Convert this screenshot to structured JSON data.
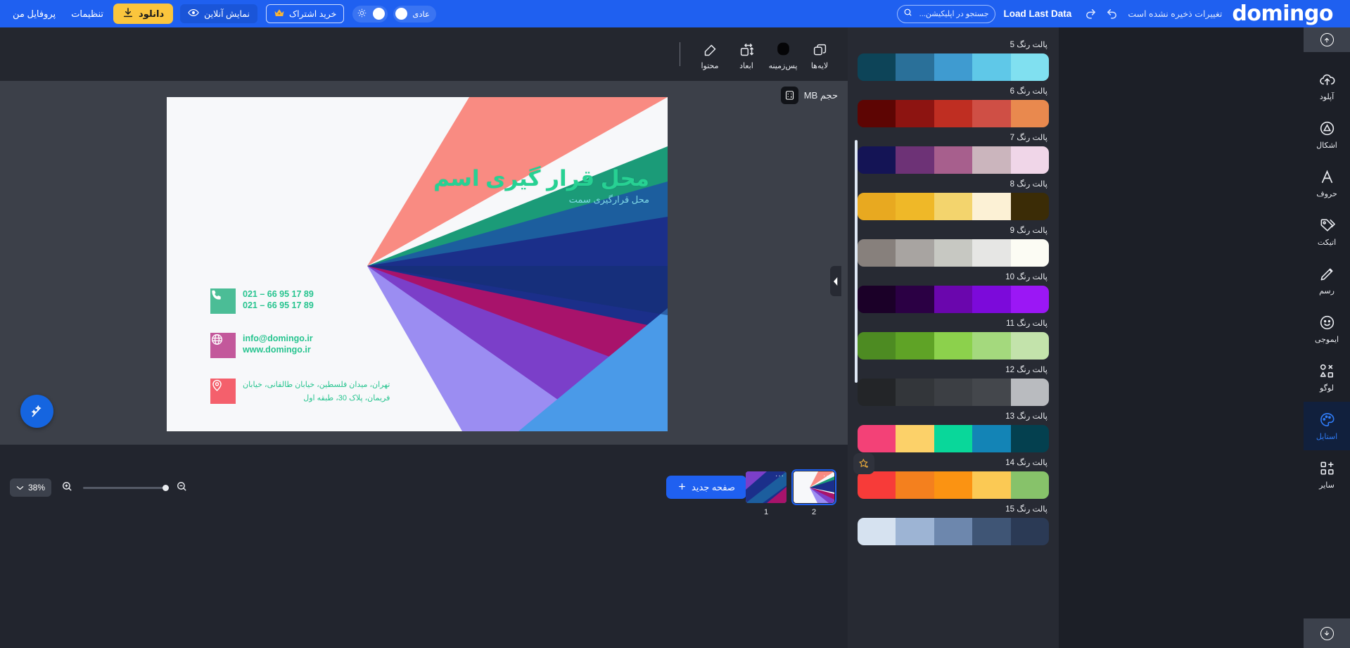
{
  "topbar": {
    "logo": "domingo",
    "save_note": "تغییرات ذخیره نشده است",
    "undo_icon": "undo-icon",
    "redo_icon": "redo-icon",
    "load_last_data": "Load Last Data",
    "search_placeholder": "جستجو در اپلیکیشن...",
    "search_value": "",
    "mode_toggle_label": "عادی",
    "theme_icon": "sun-icon",
    "subscription_label": "خرید اشتراک",
    "subscription_icon": "crown-icon",
    "preview_label": "نمایش آنلاین",
    "preview_icon": "eye-icon",
    "download_label": "دانلود",
    "download_icon": "download-icon",
    "settings_label": "تنظیمات",
    "profile_label": "پروفایل من"
  },
  "toolbar": {
    "items": [
      {
        "label": "محتوا",
        "icon": "edit-pencil-icon"
      },
      {
        "label": "ابعاد",
        "icon": "resize-icon"
      },
      {
        "label": "پس‌زمینه",
        "icon": "background-blob-icon"
      },
      {
        "label": "لایه‌ها",
        "icon": "layers-icon"
      }
    ]
  },
  "stage": {
    "size_label": "حجم MB",
    "size_icon": "calculator-icon",
    "magic_icon": "magic-wand-icon",
    "collapse_icon": "chevron-down-icon"
  },
  "card": {
    "name": "محل قرار گیری اسم",
    "subtitle": "محل قرارگیری سمت",
    "rows": [
      {
        "icon": "phone-icon",
        "icon_color": "#4bbd96",
        "lines": [
          "021 – 66 95 17 89",
          "021 – 66 95 17 89"
        ]
      },
      {
        "icon": "globe-icon",
        "icon_color": "#c3589b",
        "lines": [
          "info@domingo.ir",
          "www.domingo.ir"
        ]
      },
      {
        "icon": "location-pin-icon",
        "icon_color": "#f4606c",
        "lines": [
          "تهران، میدان فلسطین، خیابان طالقانی، خیابان",
          "فریمان، پلاک 30، طبقه اول"
        ]
      }
    ]
  },
  "bottom": {
    "zoom_level": "38%",
    "zoom_chevron": "chevron-down-icon",
    "zoom_in_icon": "zoom-in-icon",
    "zoom_out_icon": "zoom-out-icon",
    "new_page_label": "صفحه جدید",
    "new_page_icon": "plus-icon",
    "pages": [
      {
        "number": "1",
        "selected": false
      },
      {
        "number": "2",
        "selected": true
      }
    ]
  },
  "palettes": {
    "star_icon": "add-to-favorites-star-icon",
    "panel_handle_icon": "chevron-left-icon",
    "items": [
      {
        "label": "پالت رنگ 5",
        "colors": [
          "#80e0f0",
          "#5fc8e8",
          "#3f9bd0",
          "#2a7099",
          "#0d4458"
        ]
      },
      {
        "label": "پالت رنگ 6",
        "colors": [
          "#e9894e",
          "#cf4f45",
          "#bf2e22",
          "#8d1411",
          "#5d0503"
        ]
      },
      {
        "label": "پالت رنگ 7",
        "colors": [
          "#f0d6e8",
          "#cbb5bd",
          "#a75f8d",
          "#6d3276",
          "#141455"
        ]
      },
      {
        "label": "پالت رنگ 8",
        "colors": [
          "#3b2c06",
          "#fcf1d5",
          "#f3d46d",
          "#efb828",
          "#e8a920"
        ]
      },
      {
        "label": "پالت رنگ 9",
        "colors": [
          "#fcfcf4",
          "#e6e6e4",
          "#c7c8c2",
          "#a8a4a1",
          "#87807c"
        ]
      },
      {
        "label": "پالت رنگ 10",
        "colors": [
          "#9b17f5",
          "#7c0ada",
          "#6a06ad",
          "#2b0044",
          "#1b0028"
        ]
      },
      {
        "label": "پالت رنگ 11",
        "colors": [
          "#c3e3ab",
          "#a4d97d",
          "#8cd14c",
          "#5fa326",
          "#4d8b22"
        ]
      },
      {
        "label": "پالت رنگ 12",
        "colors": [
          "#b9bbbf",
          "#44474c",
          "#3c3f44",
          "#33363a",
          "#232528"
        ]
      },
      {
        "label": "پالت رنگ 13",
        "colors": [
          "#04404f",
          "#1384b6",
          "#09d79a",
          "#fcd169",
          "#f34177"
        ]
      },
      {
        "label": "پالت رنگ 14",
        "colors": [
          "#87c26a",
          "#fbc954",
          "#fb9312",
          "#f4801e",
          "#f73b39"
        ]
      },
      {
        "label": "پالت رنگ 15",
        "colors": [
          "#2b3a55",
          "#3f5575",
          "#6d87ad",
          "#9db4d4",
          "#d6e2f0"
        ]
      }
    ]
  },
  "rail": {
    "scroll_up_icon": "scroll-up-icon",
    "scroll_down_icon": "scroll-down-icon",
    "items": [
      {
        "label": "آپلود",
        "icon": "cloud-upload-icon",
        "active": false
      },
      {
        "label": "اشکال",
        "icon": "shapes-icon",
        "active": false
      },
      {
        "label": "حروف",
        "icon": "text-letter-a-icon",
        "active": false
      },
      {
        "label": "اتیکت",
        "icon": "tag-label-icon",
        "active": false
      },
      {
        "label": "رسم",
        "icon": "pencil-draw-icon",
        "active": false
      },
      {
        "label": "ایموجی",
        "icon": "smiley-emoji-icon",
        "active": false
      },
      {
        "label": "لوگو",
        "icon": "logo-shapes-icon",
        "active": false
      },
      {
        "label": "استایل",
        "icon": "palette-style-icon",
        "active": true
      },
      {
        "label": "سایر",
        "icon": "grid-plus-icon",
        "active": false
      }
    ]
  }
}
